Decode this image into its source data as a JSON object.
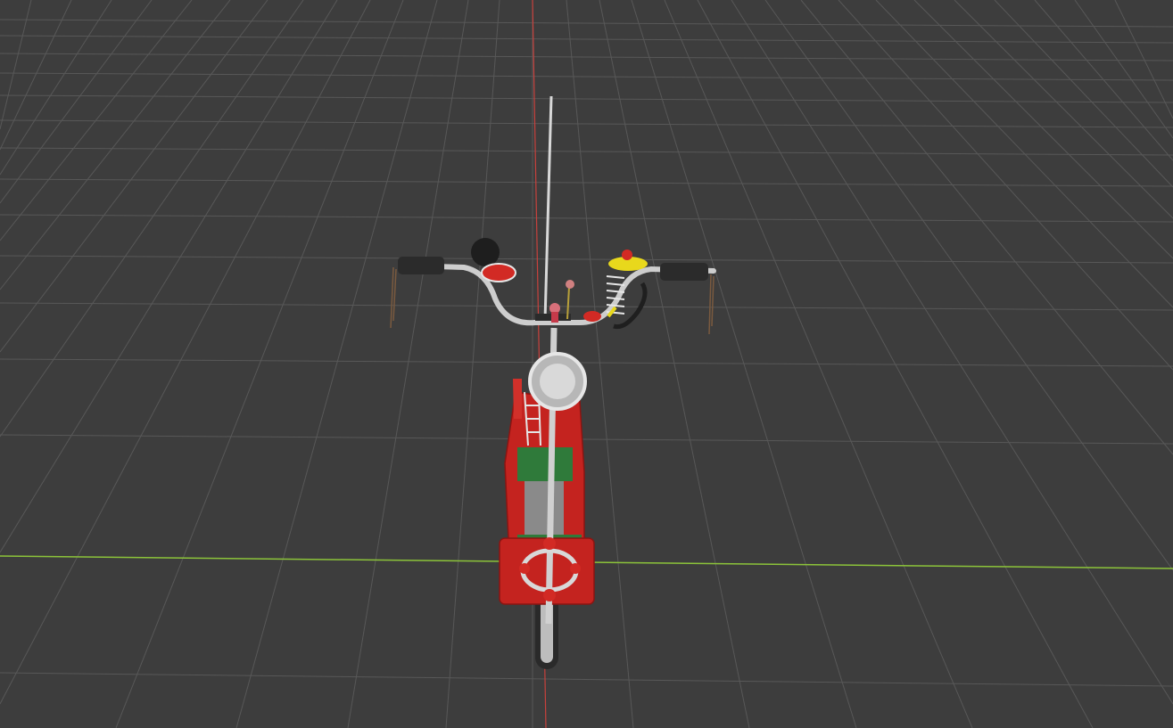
{
  "viewport": {
    "background": "#3d3d3d",
    "grid_color": "#5a5a5a",
    "x_axis_color": "#8cc43a",
    "y_axis_color": "#c8413d"
  },
  "model": {
    "body_color": "#c4231f",
    "frame_color": "#cfcfcf",
    "grip_color": "#2b2b2b",
    "accent_yellow": "#e8d81c",
    "mesh_green": "#2f7a3a"
  }
}
